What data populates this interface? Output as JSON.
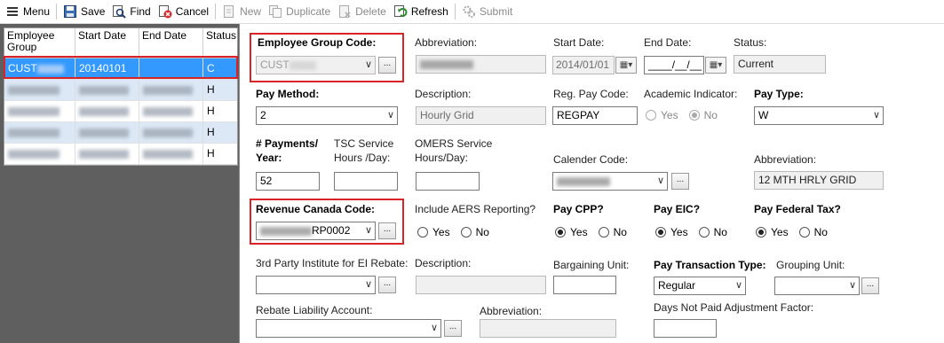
{
  "toolbar": {
    "menu": "Menu",
    "save": "Save",
    "find": "Find",
    "cancel": "Cancel",
    "new": "New",
    "duplicate": "Duplicate",
    "delete": "Delete",
    "refresh": "Refresh",
    "submit": "Submit"
  },
  "grid": {
    "headers": [
      "Employee Group",
      "Start Date",
      "End Date",
      "Status"
    ],
    "rows": [
      {
        "group": "CUST",
        "start": "20140101",
        "end": "",
        "status": "C"
      },
      {
        "group": "",
        "start": "",
        "end": "",
        "status": "H"
      },
      {
        "group": "",
        "start": "",
        "end": "",
        "status": "H"
      },
      {
        "group": "",
        "start": "",
        "end": "",
        "status": "H"
      },
      {
        "group": "",
        "start": "",
        "end": "",
        "status": "H"
      }
    ]
  },
  "form": {
    "employee_group_code_label": "Employee Group Code:",
    "employee_group_code_value": "CUST",
    "abbreviation_label": "Abbreviation:",
    "start_date_label": "Start Date:",
    "start_date_value": "2014/01/01",
    "end_date_label": "End Date:",
    "end_date_value": "____/__/__",
    "status_label": "Status:",
    "status_value": "Current",
    "pay_method_label": "Pay Method:",
    "pay_method_value": "2",
    "description_label": "Description:",
    "description_value": "Hourly Grid",
    "reg_pay_code_label": "Reg. Pay Code:",
    "reg_pay_code_value": "REGPAY",
    "academic_indicator_label": "Academic Indicator:",
    "yes": "Yes",
    "no": "No",
    "pay_type_label": "Pay Type:",
    "pay_type_value": "W",
    "payments_year_label_1": "# Payments/",
    "payments_year_label_2": "Year:",
    "payments_year_value": "52",
    "tsc_label_1": "TSC Service",
    "tsc_label_2": "Hours /Day:",
    "omers_label_1": "OMERS Service",
    "omers_label_2": "Hours/Day:",
    "calender_code_label": "Calender Code:",
    "calender_abbrev_label": "Abbreviation:",
    "calender_abbrev_value": "12 MTH HRLY GRID",
    "revenue_canada_label": "Revenue Canada Code:",
    "revenue_canada_value": "RP0002",
    "aers_label": "Include AERS Reporting?",
    "pay_cpp_label": "Pay CPP?",
    "pay_eic_label": "Pay EIC?",
    "pay_fed_tax_label": "Pay Federal Tax?",
    "third_party_label": "3rd Party Institute for EI Rebate:",
    "description2_label": "Description:",
    "bargaining_unit_label": "Bargaining Unit:",
    "pay_transaction_type_label": "Pay Transaction Type:",
    "pay_transaction_type_value": "Regular",
    "grouping_unit_label": "Grouping Unit:",
    "rebate_liability_label": "Rebate Liability Account:",
    "abbreviation3_label": "Abbreviation:",
    "days_not_paid_label": "Days Not Paid Adjustment Factor:",
    "ellipsis": "..."
  },
  "colors": {
    "selection": "#3399ff",
    "highlight": "#d9232a",
    "panel_bg": "#5f5f5f"
  }
}
